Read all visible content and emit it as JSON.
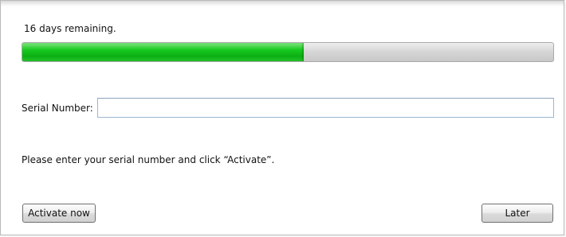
{
  "activation": {
    "status_text": "16 days remaining.",
    "progress_fraction": 0.53,
    "serial_label": "Serial Number:",
    "serial_value": "",
    "instruction_text": "Please enter your serial number and click “Activate”.",
    "buttons": {
      "activate_now": "Activate now",
      "later": "Later"
    }
  },
  "colors": {
    "progress_green": "#18c91f",
    "progress_track": "#d7d7d7",
    "input_border": "#9ab6d1"
  }
}
